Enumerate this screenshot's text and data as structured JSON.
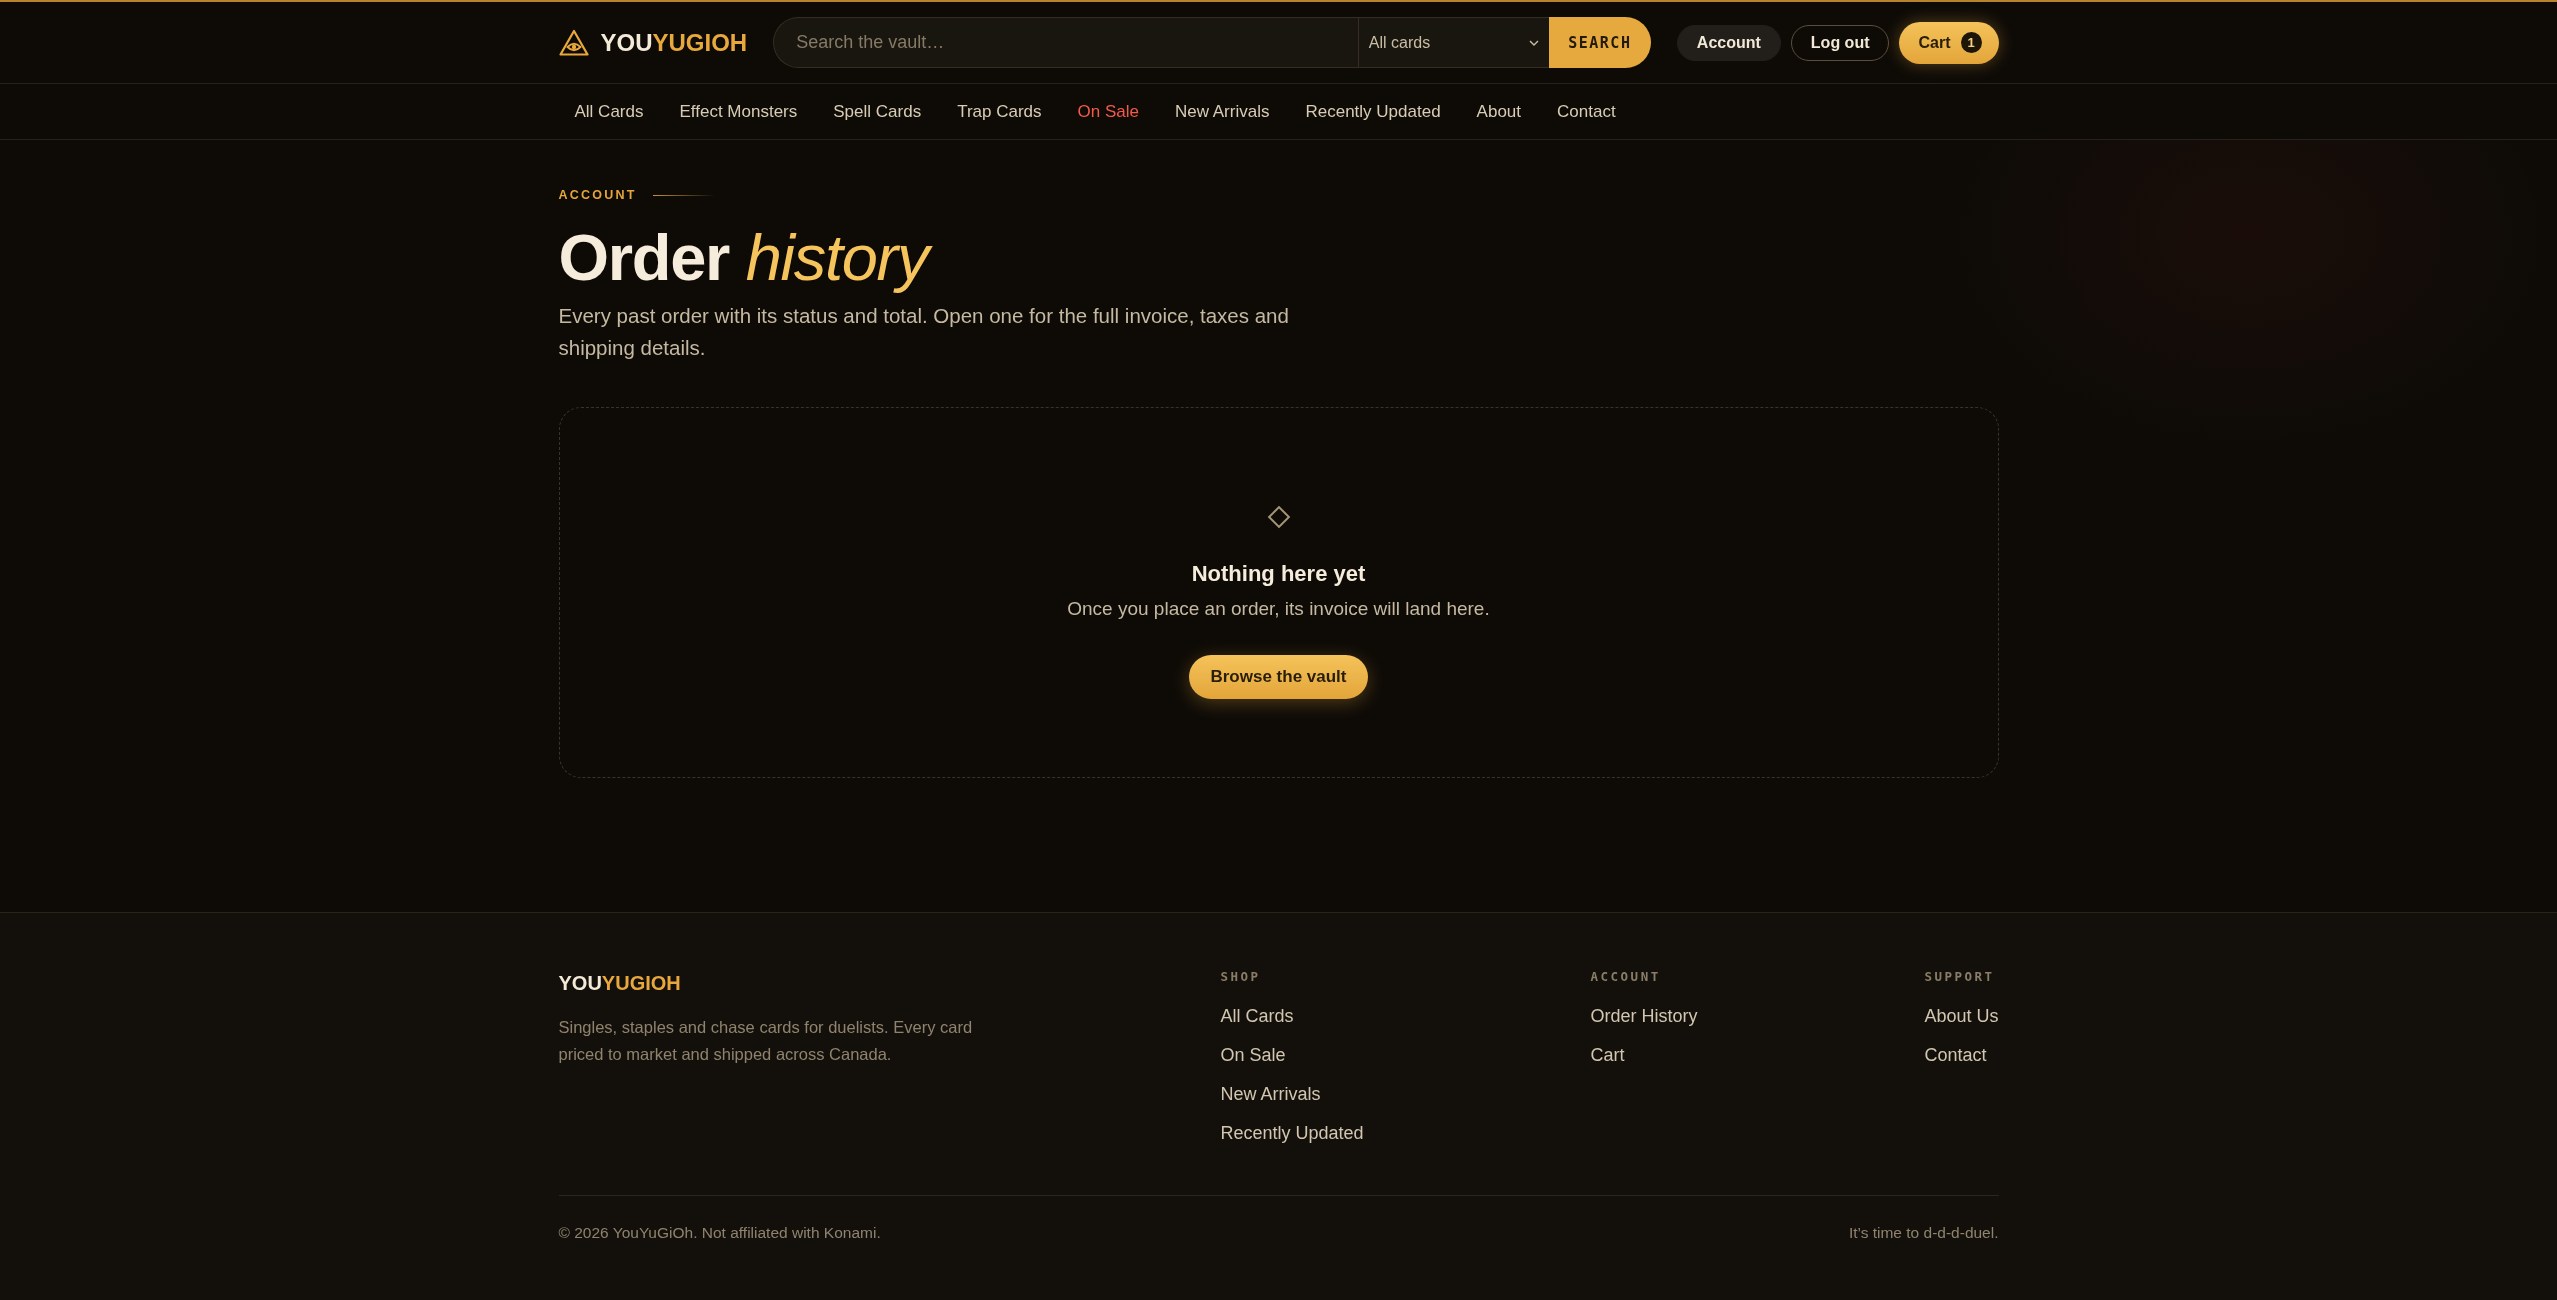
{
  "header": {
    "logo": {
      "lead": "YOU",
      "accent": "YUGIOH"
    },
    "search": {
      "placeholder": "Search the vault…",
      "category": "All cards",
      "button": "SEARCH"
    },
    "actions": [
      {
        "kind": "secondary",
        "label": "Account"
      },
      {
        "kind": "outline",
        "label": "Log out"
      },
      {
        "kind": "primary",
        "label": "Cart",
        "badge": "1"
      }
    ]
  },
  "nav": [
    {
      "label": "All Cards",
      "highlighted": false
    },
    {
      "label": "Effect Monsters",
      "highlighted": false
    },
    {
      "label": "Spell Cards",
      "highlighted": false
    },
    {
      "label": "Trap Cards",
      "highlighted": false
    },
    {
      "label": "On Sale",
      "highlighted": true
    },
    {
      "label": "New Arrivals",
      "highlighted": false
    },
    {
      "label": "Recently Updated",
      "highlighted": false
    },
    {
      "label": "About",
      "highlighted": false
    },
    {
      "label": "Contact",
      "highlighted": false
    }
  ],
  "page": {
    "eyebrow": "ACCOUNT",
    "title": "Order *history*",
    "description": "Every past order with its status and total. Open one for the full invoice, taxes and shipping details."
  },
  "empty_state": {
    "title": "Nothing here yet",
    "message": "Once you place an order, its invoice will land here.",
    "button": "Browse the vault"
  },
  "footer": {
    "logo": {
      "lead": "YOU",
      "accent": "YUGIOH"
    },
    "description": "Singles, staples and chase cards for duelists. Every card priced to market and shipped across Canada.",
    "columns": [
      {
        "heading": "SHOP",
        "links": [
          "All Cards",
          "On Sale",
          "New Arrivals",
          "Recently Updated"
        ]
      },
      {
        "heading": "ACCOUNT",
        "links": [
          "Order History",
          "Cart"
        ]
      },
      {
        "heading": "SUPPORT",
        "links": [
          "About Us",
          "Contact"
        ]
      }
    ],
    "copyright": "© 2026 YouYuGiOh. Not affiliated with Konami.",
    "tagline": "It’s time to d-d-d-duel."
  }
}
